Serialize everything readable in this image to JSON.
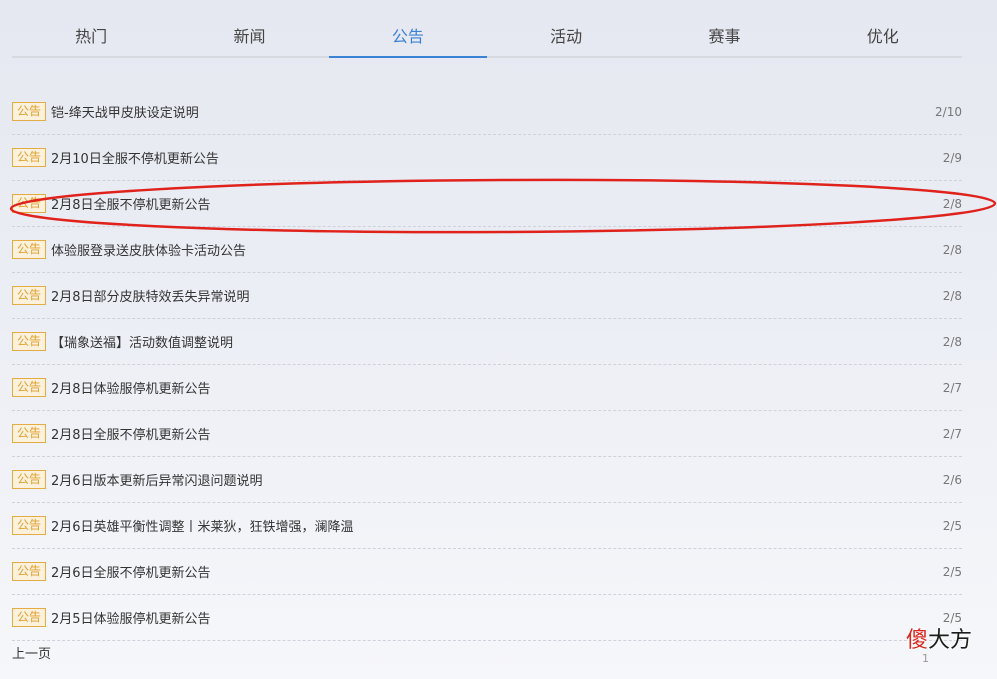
{
  "tabs": [
    {
      "label": "热门"
    },
    {
      "label": "新闻"
    },
    {
      "label": "公告"
    },
    {
      "label": "活动"
    },
    {
      "label": "赛事"
    },
    {
      "label": "优化"
    }
  ],
  "active_tab": "公告",
  "tag_label": "公告",
  "items": [
    {
      "title": "铠-绛天战甲皮肤设定说明",
      "date": "2/10"
    },
    {
      "title": "2月10日全服不停机更新公告",
      "date": "2/9"
    },
    {
      "title": "2月8日全服不停机更新公告",
      "date": "2/8"
    },
    {
      "title": "体验服登录送皮肤体验卡活动公告",
      "date": "2/8"
    },
    {
      "title": "2月8日部分皮肤特效丢失异常说明",
      "date": "2/8"
    },
    {
      "title": "【瑞象送福】活动数值调整说明",
      "date": "2/8"
    },
    {
      "title": "2月8日体验服停机更新公告",
      "date": "2/7"
    },
    {
      "title": "2月8日全服不停机更新公告",
      "date": "2/7"
    },
    {
      "title": "2月6日版本更新后异常闪退问题说明",
      "date": "2/6"
    },
    {
      "title": "2月6日英雄平衡性调整丨米莱狄，狂铁增强，澜降温",
      "date": "2/5"
    },
    {
      "title": "2月6日全服不停机更新公告",
      "date": "2/5"
    },
    {
      "title": "2月5日体验服停机更新公告",
      "date": "2/5"
    }
  ],
  "highlighted_item": 2,
  "pagination": {
    "prev_label": "上一页",
    "page_indicator": "1"
  },
  "watermark": {
    "part1": "傻",
    "part2": "大方"
  },
  "colors": {
    "accent": "#3b82d6",
    "tag_text": "#e0a130",
    "tag_border": "#e3ac45",
    "tag_bg": "#fbf1dc",
    "annotation": "#e0221c"
  }
}
